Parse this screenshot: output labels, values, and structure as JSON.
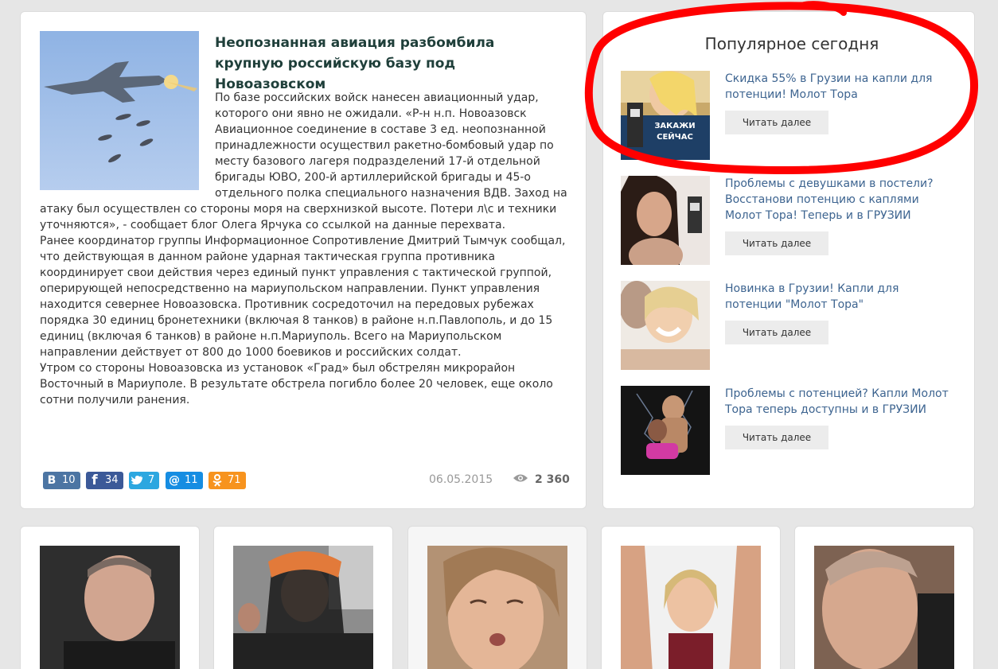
{
  "article": {
    "title": "Неопознанная авиация разбомбила крупную российскую базу под Новоазовском",
    "paragraphs": [
      "По базе российских войск нанесен авиационный удар, которого они явно не ожидали. «Р-н н.п. Новоазовск Авиационное соединение в составе 3 ед. неопознанной принадлежности осуществил ракетно-бомбовый удар по месту базового лагеря подразделений 17-й отдельной бригады ЮВО, 200-й артиллерийской бригады и 45-о отдельного полка специального назначения ВДВ. Заход на атаку был осуществлен со стороны моря на сверхнизкой высоте. Потери л\\с и техники уточняются», - сообщает блог Олега Ярчука со ссылкой на данные перехвата.",
      "Ранее координатор группы Информационное Сопротивление Дмитрий Тымчук сообщал, что действующая в данном районе ударная тактическая группа противника координирует свои действия через единый пункт управления с тактической группой, оперирующей непосредственно на мариупольском направлении. Пункт управления находится севернее Новоазовска. Противник сосредоточил на передовых рубежах порядка 30 единиц бронетехники (включая 8 танков) в районе н.п.Павлополь, и до 15 единиц (включая 6 танков) в районе н.п.Мариуполь. Всего на Мариупольском направлении действует от 800 до 1000 боевиков и российских солдат.",
      "Утром со стороны Новоазовска из установок «Град» был обстрелян микрорайон Восточный в Мариуполе. В результате обстрела погибло более 20 человек, еще около сотни получили ранения."
    ],
    "date": "06.05.2015",
    "views": "2 360",
    "shares": {
      "vk": {
        "icon": "В",
        "count": "10"
      },
      "fb": {
        "icon": "f",
        "count": "34"
      },
      "tw": {
        "icon": "t",
        "count": "7"
      },
      "mr": {
        "icon": "@",
        "count": "11"
      },
      "ok": {
        "icon": "ok",
        "count": "71"
      }
    }
  },
  "sidebar": {
    "title": "Популярное сегодня",
    "items": [
      {
        "text": "Скидка 55% в Грузии на капли для потенции! Молот Тора",
        "button": "Читать далее",
        "thumb_caption": "ЗАКАЖИ СЕЙЧАС"
      },
      {
        "text": "Проблемы с девушками в постели? Восстанови потенцию с каплями Молот Тора! Теперь и в ГРУЗИИ",
        "button": "Читать далее"
      },
      {
        "text": "Новинка в Грузии! Капли для потенции \"Молот Тора\"",
        "button": "Читать далее"
      },
      {
        "text": "Проблемы с потенцией? Капли Молот Тора теперь доступны и в ГРУЗИИ",
        "button": "Читать далее"
      }
    ]
  },
  "colors": {
    "link": "#3d6490",
    "title": "#1f3f3a",
    "annotation": "#ff0000"
  }
}
